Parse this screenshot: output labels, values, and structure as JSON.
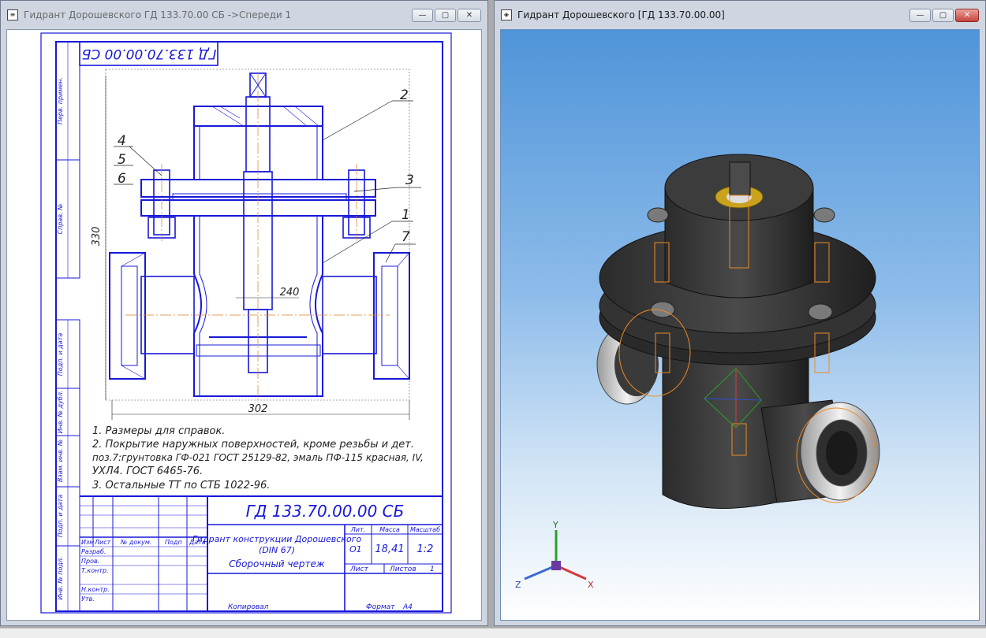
{
  "left_window": {
    "title": "Гидрант Дорошевского ГД 133.70.00 СБ ->Спереди 1",
    "btn_min": "—",
    "btn_max": "▢",
    "btn_close": "✕"
  },
  "right_window": {
    "title": "Гидрант Дорошевского [ГД 133.70.00.00]",
    "btn_min": "—",
    "btn_max": "▢",
    "btn_close": "✕"
  },
  "drawing": {
    "rotated_code": "ГД 133.70.00.00 СБ",
    "left_strip": [
      "Перв. примен.",
      "Справ. №",
      "Подп. и дата",
      "Инв. № дубл.",
      "Взам. инв. №",
      "Подп. и дата",
      "Инв. № подл."
    ],
    "callouts": [
      "2",
      "3",
      "1",
      "7",
      "4",
      "5",
      "6"
    ],
    "dim_height": "330",
    "dim_width": "302",
    "dim_inner": "240",
    "notes": [
      "1. Размеры для справок.",
      "2. Покрытие наружных поверхностей, кроме резьбы и дет.",
      "поз.7:грунтовка ГФ-021 ГОСТ 25129-82, эмаль ПФ-115 красная, IV,",
      "УХЛ4. ГОСТ 6465-76.",
      "3. Остальные ТТ по СТБ 1022-96."
    ],
    "title_block": {
      "designation": "ГД 133.70.00.00 СБ",
      "name_line1": "Гидрант конструкции Дорошевского",
      "name_line2": "(DIN 67)",
      "name_line3": "Сборочный чертеж",
      "col_izm": "Изм",
      "col_list": "Лист",
      "col_doc": "№ докум.",
      "col_sign": "Подп",
      "col_date": "Дата",
      "row_razrab": "Разраб.",
      "row_prov": "Пров.",
      "row_tkontr": "Т.контр.",
      "row_nkontr": "Н.контр.",
      "row_utv": "Утв.",
      "lit_label": "Лит.",
      "mass_label": "Масса",
      "scale_label": "Масштаб",
      "lit_value": "О1",
      "mass_value": "18,41",
      "scale_value": "1:2",
      "sheet_label": "Лист",
      "sheets_label": "Листов",
      "sheets_value": "1",
      "copied": "Копировал",
      "format_label": "Формат",
      "format_value": "А4"
    }
  },
  "axes3d": {
    "x": "X",
    "y": "Y",
    "z": "Z"
  },
  "colors": {
    "accent": "#1818d8",
    "close_red": "#c6453c",
    "sky": "#4f94d9",
    "orange": "#f08a24"
  }
}
